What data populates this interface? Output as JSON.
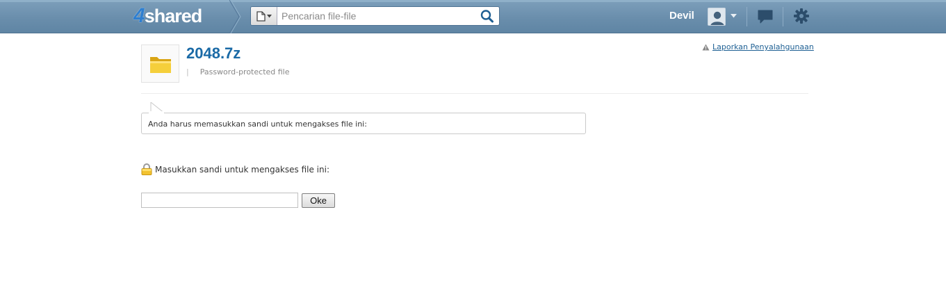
{
  "header": {
    "logo_number": "4",
    "logo_text": "shared",
    "search_placeholder": "Pencarian file-file",
    "user_name": "Devil"
  },
  "file": {
    "title": "2048.7z",
    "separator": "|",
    "subtitle": "Password-protected file",
    "report_link": "Laporkan Penyalahgunaan"
  },
  "notice": {
    "message": "Anda harus memasukkan sandi untuk mengakses file ini:"
  },
  "password": {
    "label": "Masukkan sandi untuk mengakses file ini:",
    "value": "",
    "ok_label": "Oke"
  },
  "colors": {
    "header_bg": "#6a8eac",
    "title": "#1a6aa6",
    "link": "#1d5f93"
  },
  "icons": {
    "file_type": "document-icon",
    "search": "search-icon",
    "avatar": "user-icon",
    "messages": "chat-icon",
    "settings": "gear-icon",
    "folder": "folder-icon",
    "warning": "warning-icon",
    "lock": "lock-icon"
  }
}
